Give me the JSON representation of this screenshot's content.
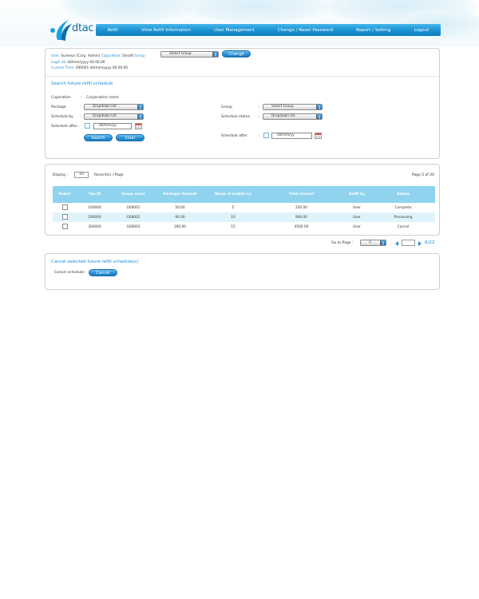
{
  "brand": {
    "logo_text": "dtac"
  },
  "nav": [
    "Refill",
    "View Refill Information",
    "User Management",
    "Change / Reset Password",
    "Report / Setting",
    "Logout"
  ],
  "user_info": {
    "user_label": "User:",
    "user_value": "Sureeya (Corp. Admin)",
    "corp_label": "Coporation:",
    "corp_value": "Dnsoft",
    "group_label": "Group",
    "group_select": "Select Group",
    "change_button": "Change",
    "login_label": "Login at:",
    "login_value": "dd/mm/yyyy 00.00.00",
    "time_label": "Current Time:",
    "time_value": "000001 dd/mm/yyyy 00.00.00"
  },
  "search": {
    "title": "Search future refill schedule",
    "corporation_label": "Coporation",
    "corporation_value": "Corporation name",
    "package_label": "Package",
    "package_select": "Dropdown list",
    "schedule_by_label": "Schedule by",
    "schedule_by_select": "Dropdown list",
    "schedule_after_label": "Schedule after :",
    "schedule_after_date": "dd/mm/yy",
    "group_label": "Group",
    "group_select": "Select Group",
    "status_label": "Schedule status",
    "status_select": "Dropdown list",
    "schedule_after2_label": "Schedule after",
    "schedule_after2_date": "dd/mm/yy",
    "search_button": "Search",
    "clear_button": "Clear",
    "colon": ":"
  },
  "results": {
    "display_label": "Display :",
    "display_value": "10",
    "display_suffix": "Record(s) / Page",
    "page_info": "Page 2 of 20",
    "columns": [
      "Select",
      "Tpn ID",
      "Group name",
      "Package/ Amount",
      "Name of mobile no",
      "Total amount",
      "Refill by",
      "Status"
    ],
    "rows": [
      [
        "",
        "100000",
        "G00001",
        "50.00",
        "5",
        "250.00",
        "User",
        "Complete"
      ],
      [
        "",
        "200000",
        "G00002",
        "90.00",
        "10",
        "900.00",
        "User",
        "Processing"
      ],
      [
        "",
        "300000",
        "G00003",
        "300.00",
        "15",
        "4500.00",
        "User",
        "Cancel"
      ]
    ]
  },
  "pager": {
    "goto_label": "Go to Page :",
    "goto_select": "2",
    "page_input": "",
    "page_count": "6/22"
  },
  "cancel": {
    "title": "Cancel selected future refill schedule(s)",
    "label": "Cancel schedule:",
    "button": "Cancel"
  }
}
